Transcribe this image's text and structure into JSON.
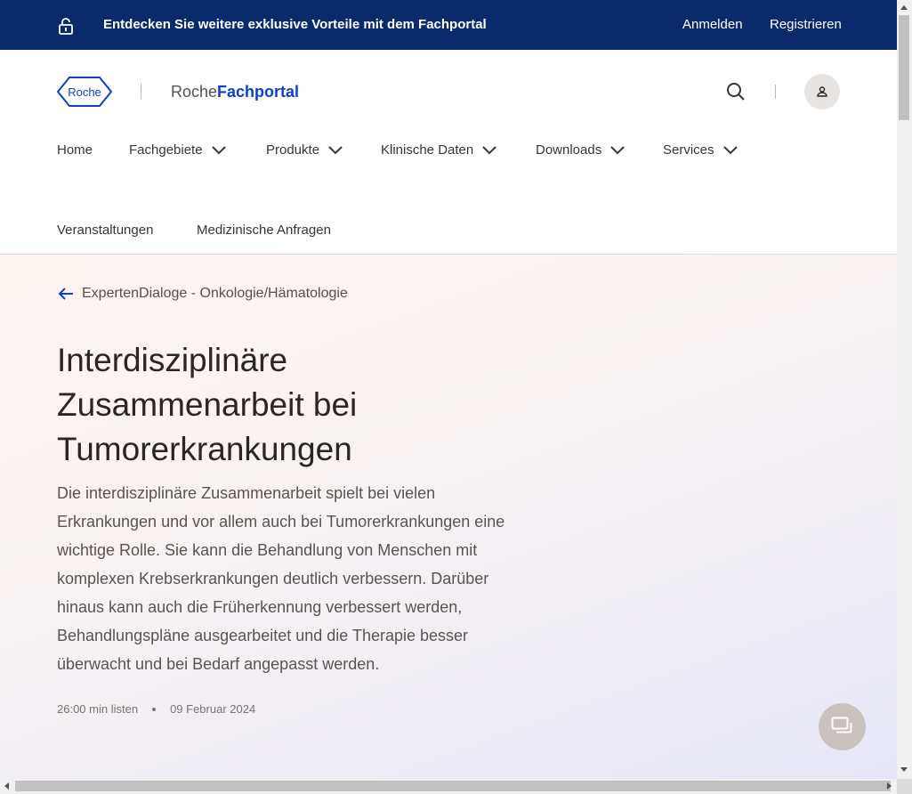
{
  "topbar": {
    "promo": "Entdecken Sie weitere exklusive Vorteile mit dem Fachportal",
    "login": "Anmelden",
    "register": "Registrieren",
    "lock_icon": "unlock-icon"
  },
  "header": {
    "logo_text": "Roche",
    "brand_prefix": "Roche",
    "brand_suffix": "Fachportal",
    "search_icon": "search-icon",
    "user_icon": "user-icon"
  },
  "nav": {
    "items": [
      {
        "label": "Home",
        "has_dropdown": false
      },
      {
        "label": "Fachgebiete",
        "has_dropdown": true
      },
      {
        "label": "Produkte",
        "has_dropdown": true
      },
      {
        "label": "Klinische Daten",
        "has_dropdown": true
      },
      {
        "label": "Downloads",
        "has_dropdown": true
      },
      {
        "label": "Services",
        "has_dropdown": true
      },
      {
        "label": "Veranstaltungen",
        "has_dropdown": false
      },
      {
        "label": "Medizinische Anfragen",
        "has_dropdown": false
      }
    ]
  },
  "hero": {
    "back_label": "ExpertenDialoge - Onkologie/Hämatologie",
    "title": "Interdisziplinäre Zusammenarbeit bei Tumorerkrankungen",
    "lead": "Die interdisziplinäre Zusammenarbeit spielt bei vielen Erkrankungen und vor allem auch bei Tumorerkrankungen eine wichtige Rolle. Sie kann die Behandlung von Menschen mit komplexen Krebserkrankungen deutlich verbessern. Darüber hinaus kann auch die Früherkennung verbessert werden, Behandlungspläne ausgearbeitet und die Therapie besser überwacht und bei Bedarf angepasst werden.",
    "duration": "26:00 min listen",
    "date": "09 Februar 2024"
  },
  "colors": {
    "topbar_bg": "#0b2a6b",
    "brand_blue": "#0b41cd",
    "text_dark": "#2b2624",
    "chat_bg": "#c9c1bd"
  }
}
